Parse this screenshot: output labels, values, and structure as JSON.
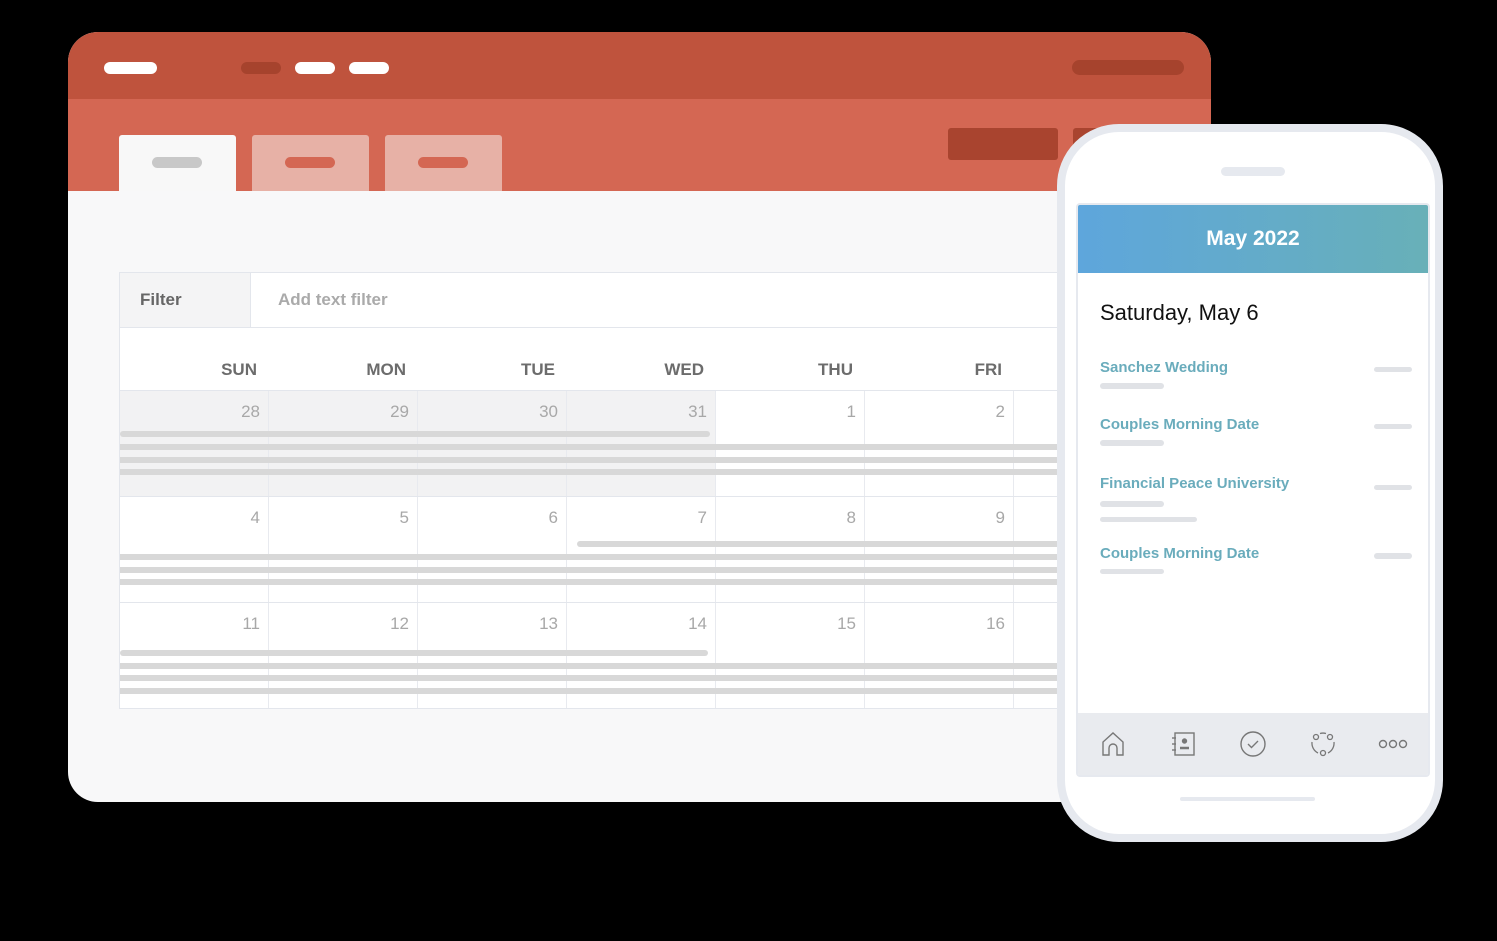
{
  "calendar": {
    "filter_label": "Filter",
    "filter_placeholder": "Add text filter",
    "weekdays": [
      "SUN",
      "MON",
      "TUE",
      "WED",
      "THU",
      "FRI"
    ],
    "weeks": [
      [
        "28",
        "29",
        "30",
        "31",
        "1",
        "2"
      ],
      [
        "4",
        "5",
        "6",
        "7",
        "8",
        "9"
      ],
      [
        "11",
        "12",
        "13",
        "14",
        "15",
        "16"
      ]
    ]
  },
  "phone": {
    "month_title": "May 2022",
    "selected_date": "Saturday, May 6",
    "events": [
      "Sanchez Wedding",
      "Couples Morning Date",
      "Financial Peace University",
      "Couples Morning Date"
    ],
    "nav": [
      "home-icon",
      "directory-icon",
      "check-circle-icon",
      "groups-icon",
      "more-icon"
    ]
  },
  "colors": {
    "brand": "#bf533d",
    "tabbar": "#d46753",
    "event_text": "#6aacbc",
    "header_gradient_start": "#5ea6dc",
    "header_gradient_end": "#68b0b8"
  }
}
